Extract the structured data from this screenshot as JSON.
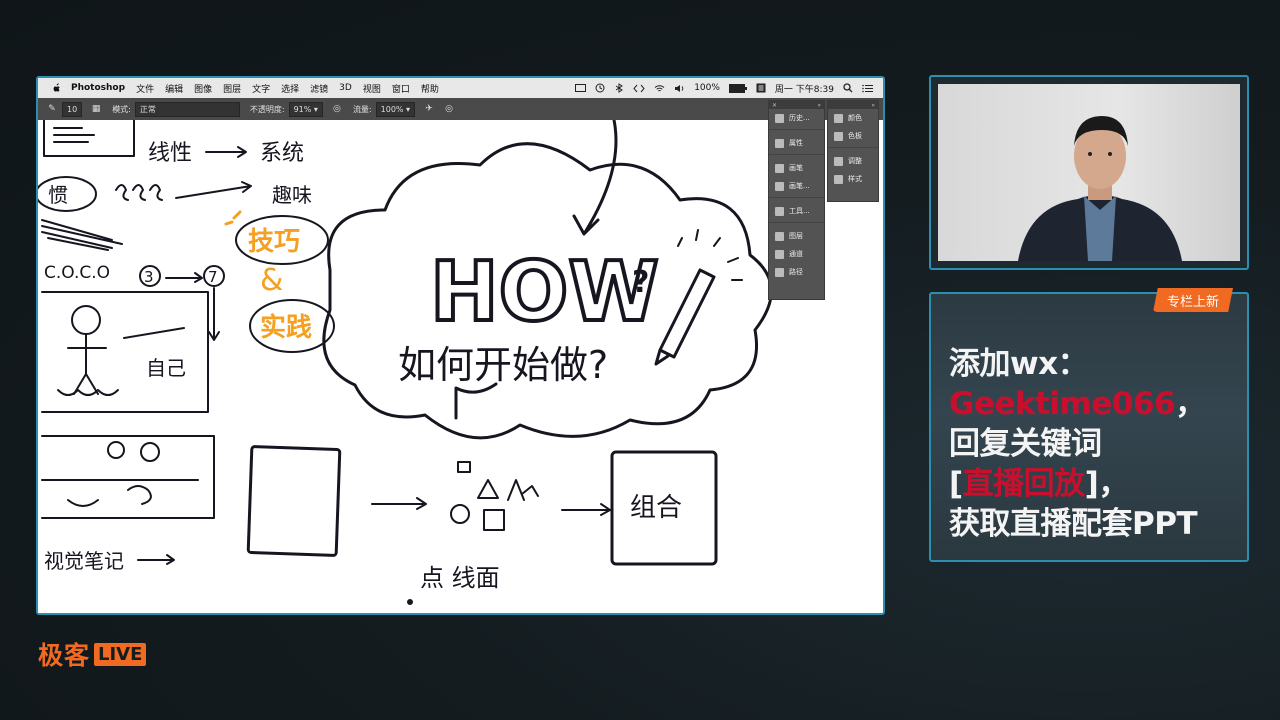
{
  "menubar": {
    "app": "Photoshop",
    "items": [
      "文件",
      "编辑",
      "图像",
      "图层",
      "文字",
      "选择",
      "滤镜",
      "3D",
      "视图",
      "窗口",
      "帮助"
    ],
    "battery": "100%",
    "datetime": "周一 下午8:39"
  },
  "options_bar": {
    "brush_size": "10",
    "mode_label": "模式:",
    "mode_value": "正常",
    "opacity_label": "不透明度:",
    "opacity_value": "91%",
    "flow_label": "流量:",
    "flow_value": "100%"
  },
  "panels": {
    "left": [
      "历史...",
      "属性",
      "画笔",
      "画笔...",
      "工具...",
      "图层",
      "通道",
      "路径"
    ],
    "right": [
      "颜色",
      "色板",
      "调整",
      "样式"
    ]
  },
  "sketch": {
    "left_words": [
      "线性",
      "系统",
      "惯",
      "趣味",
      "C.O.C.O",
      "3",
      "7",
      "自己",
      "视觉笔记"
    ],
    "orange_words": [
      "技巧",
      "&",
      "实践"
    ],
    "how": "HOW",
    "question": "如何开始做?",
    "group": "组合",
    "bottom": "点 线面"
  },
  "info_panel": {
    "badge": "专栏上新",
    "line1": "添加wx：",
    "line2": "Geektime066",
    "line2_suffix": "，",
    "line3": "回复关键词",
    "line4_open": "[",
    "line4_keyword": "直播回放",
    "line4_close": "]，",
    "line5": "获取直播配套PPT"
  },
  "logo": {
    "text": "极客",
    "live": "LIVE"
  }
}
